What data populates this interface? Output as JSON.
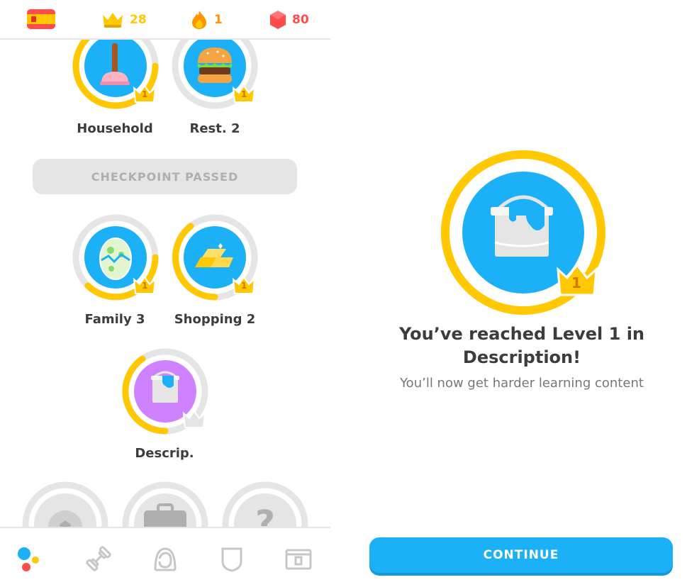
{
  "header": {
    "language_flag": "spanish-flag",
    "crowns": "28",
    "streak": "1",
    "gems": "80",
    "colors": {
      "crown": "#ffc800",
      "streak": "#ff9600",
      "gems": "#ff4b4b"
    }
  },
  "skills": [
    {
      "label": "Household",
      "icon": "plunger-icon",
      "level": "1"
    },
    {
      "label": "Rest. 2",
      "icon": "burger-icon",
      "level": "1"
    },
    {
      "label": "Family 3",
      "icon": "egg-icon",
      "level": "1"
    },
    {
      "label": "Shopping 2",
      "icon": "gold-bars-icon",
      "level": "1"
    },
    {
      "label": "Descrip.",
      "icon": "paint-bucket-icon",
      "level": ""
    }
  ],
  "checkpoint": {
    "label": "CHECKPOINT PASSED"
  },
  "locked_skills": [
    {
      "icon": "soccer-ball-icon"
    },
    {
      "icon": "briefcase-icon"
    },
    {
      "icon": "question-mark-icon"
    }
  ],
  "bottom_nav": [
    {
      "name": "learn-tab",
      "icon": "learn-icon"
    },
    {
      "name": "practice-tab",
      "icon": "dumbbell-icon"
    },
    {
      "name": "profile-tab",
      "icon": "profile-icon"
    },
    {
      "name": "leagues-tab",
      "icon": "shield-icon"
    },
    {
      "name": "shop-tab",
      "icon": "shop-icon"
    }
  ],
  "level_up": {
    "badge_level": "1",
    "title_line1": "You’ve reached Level 1 in",
    "title_line2": "Description!",
    "subtitle": "You’ll now get harder learning content",
    "continue_label": "CONTINUE"
  },
  "colors": {
    "accent_blue": "#1cb0f6",
    "gold": "#ffc800",
    "ring_gray": "#e5e5e5",
    "purple": "#ce82ff"
  }
}
